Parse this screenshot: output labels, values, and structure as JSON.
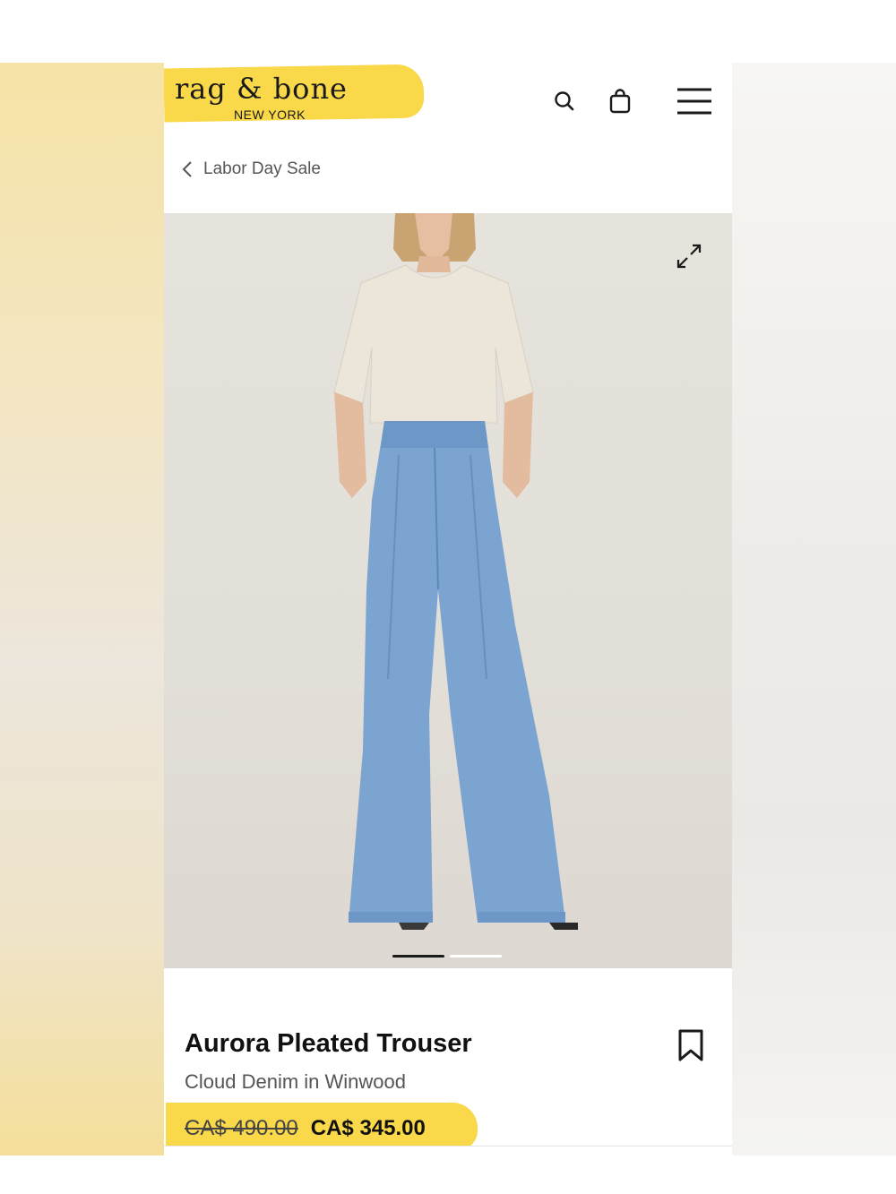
{
  "brand": {
    "name": "rag & bone",
    "sub": "NEW YORK"
  },
  "header": {
    "icons": [
      "search-icon",
      "shopping-bag-icon",
      "hamburger-menu-icon"
    ]
  },
  "breadcrumb": {
    "back_label": "Labor Day Sale"
  },
  "gallery": {
    "expand_icon": "expand-icon",
    "slide_count": 2,
    "active_slide": 1
  },
  "product": {
    "title": "Aurora Pleated Trouser",
    "subtitle": "Cloud Denim in Winwood",
    "price_original": "CA$ 490.00",
    "price_sale": "CA$ 345.00",
    "save_icon": "bookmark-icon"
  },
  "colors": {
    "highlight": "#f9d84a",
    "text": "#111111",
    "muted": "#555555"
  }
}
